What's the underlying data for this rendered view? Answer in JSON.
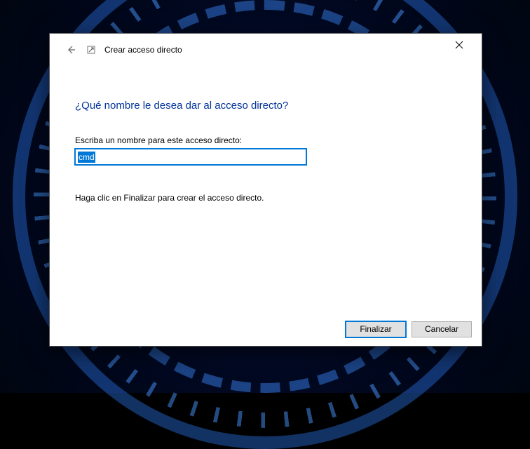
{
  "header": {
    "title": "Crear acceso directo"
  },
  "main": {
    "heading": "¿Qué nombre le desea dar al acceso directo?",
    "input_label": "Escriba un nombre para este acceso directo:",
    "input_value": "cmd",
    "hint": "Haga clic en Finalizar para crear el acceso directo."
  },
  "footer": {
    "finish": "Finalizar",
    "cancel": "Cancelar"
  }
}
